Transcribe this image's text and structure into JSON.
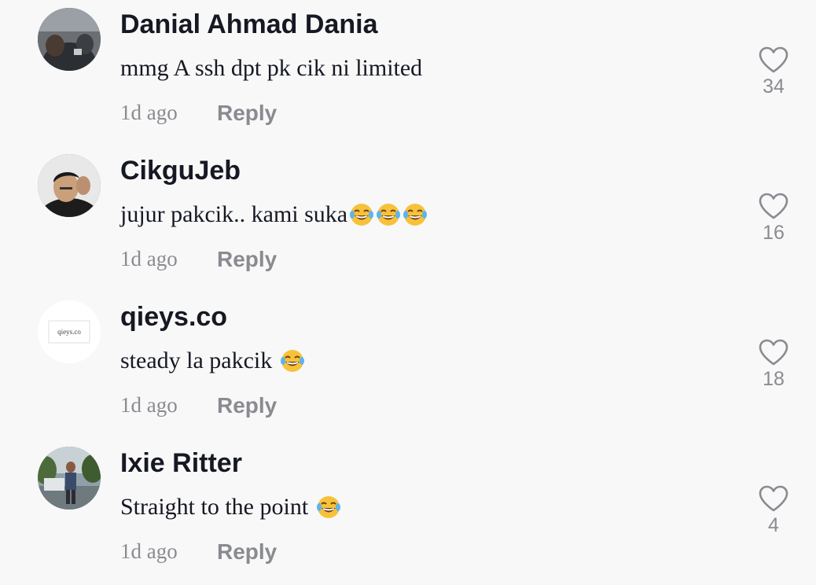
{
  "comments": [
    {
      "username": "Danial Ahmad Dania",
      "text": "mmg A ssh dpt pk cik ni limited",
      "emoji_count": 0,
      "time": "1d ago",
      "reply_label": "Reply",
      "likes": "34",
      "avatar_icon": "user-photo-avatar"
    },
    {
      "username": "CikguJeb",
      "text": "jujur pakcik.. kami suka",
      "emoji_count": 3,
      "time": "1d ago",
      "reply_label": "Reply",
      "likes": "16",
      "avatar_icon": "user-photo-avatar"
    },
    {
      "username": "qieys.co",
      "text": "steady la pakcik ",
      "emoji_count": 1,
      "time": "1d ago",
      "reply_label": "Reply",
      "likes": "18",
      "avatar_icon": "logo-avatar",
      "avatar_logo_text": "qieys.co"
    },
    {
      "username": "Ixie Ritter",
      "text": "Straight to the point ",
      "emoji_count": 1,
      "time": "1d ago",
      "reply_label": "Reply",
      "likes": "4",
      "avatar_icon": "user-photo-avatar"
    }
  ],
  "icons": {
    "like": "heart-outline-icon",
    "emoji": "face-with-tears-of-joy-emoji"
  },
  "colors": {
    "background": "#f8f8f8",
    "primary_text": "#161823",
    "secondary_text": "#8a8b91"
  }
}
